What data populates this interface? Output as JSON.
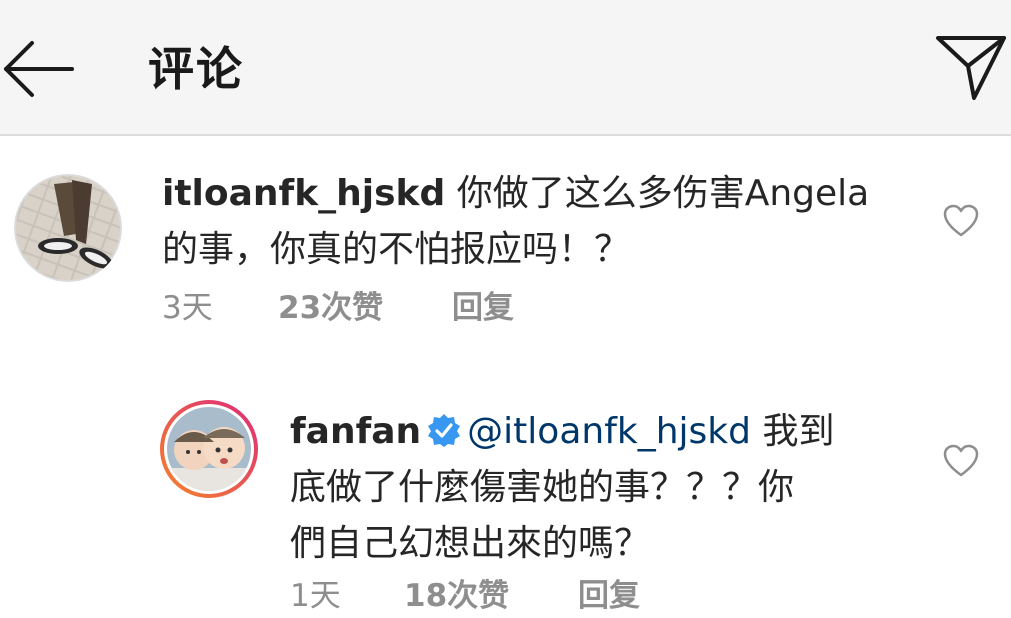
{
  "header": {
    "title": "评论",
    "back_icon": "back-arrow-icon",
    "send_icon": "send-direct-icon"
  },
  "comments": [
    {
      "username": "itloanfk_hjskd",
      "text": "你做了这么多伤害Angela的事，你真的不怕报应吗！？",
      "line1": " 你做了这么多伤害Angela",
      "line2": "的事，你真的不怕报应吗！？",
      "time": "3天",
      "likes": "23次赞",
      "reply": "回复"
    },
    {
      "username": "fanfan",
      "verified": true,
      "mention": "@itloanfk_hjskd",
      "line1_tail": " 我到",
      "line2": "底做了什麼傷害她的事？？？你",
      "line3": "們自己幻想出來的嗎？",
      "time": "1天",
      "likes": "18次赞",
      "reply": "回复"
    }
  ],
  "colors": {
    "header_bg": "#f5f5f5",
    "text": "#262626",
    "meta": "#8e8e8e",
    "mention": "#00376b",
    "verified": "#3897f0",
    "story_ring_start": "#f58529",
    "story_ring_end": "#dd2a7b"
  }
}
